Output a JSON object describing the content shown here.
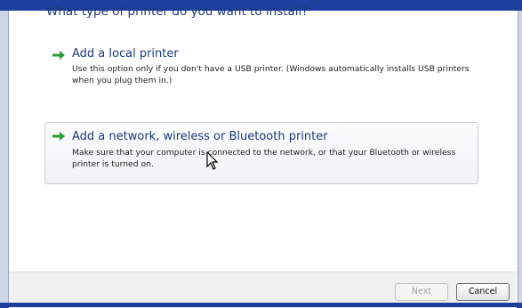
{
  "wizard": {
    "question": "What type of printer do you want to install?"
  },
  "options": [
    {
      "title": "Add a local printer",
      "description": "Use this option only if you don't have a USB printer. (Windows automatically installs USB printers when you plug them in.)",
      "icon": "green-arrow-icon"
    },
    {
      "title": "Add a network, wireless or Bluetooth printer",
      "description": "Make sure that your computer is connected to the network, or that your Bluetooth or wireless printer is turned on.",
      "icon": "green-arrow-icon"
    }
  ],
  "buttons": {
    "next": "Next",
    "cancel": "Cancel"
  },
  "colors": {
    "accent": "#1e3a78",
    "arrow": "#2e9b3a",
    "frame": "#1f3f9e"
  }
}
